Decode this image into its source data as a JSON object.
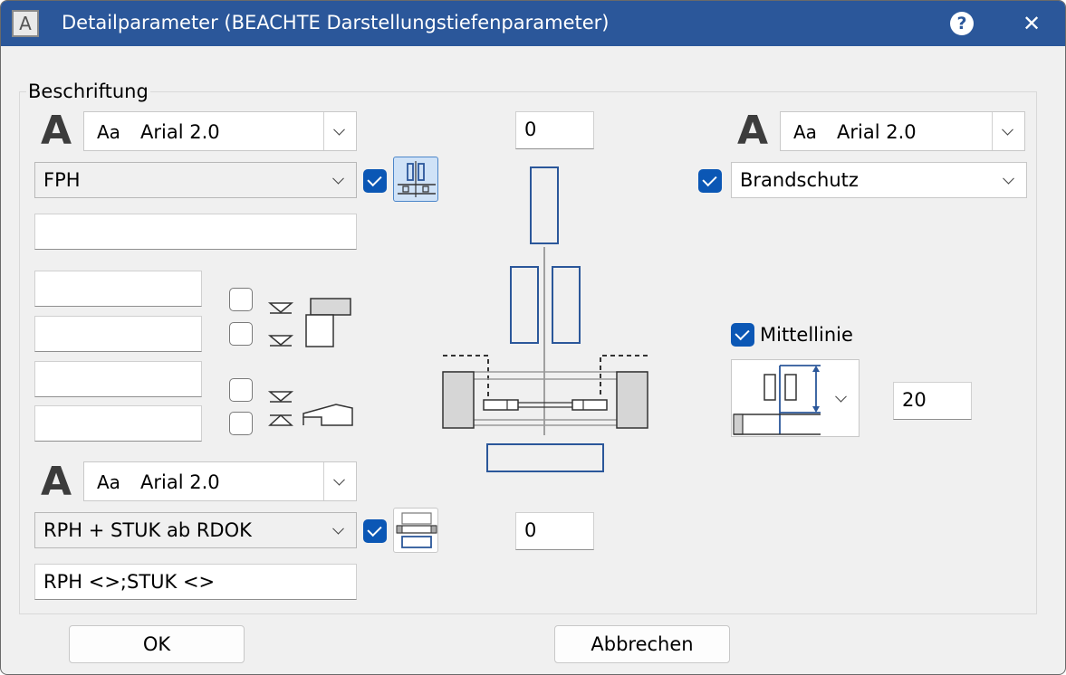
{
  "window": {
    "title": "Detailparameter (BEACHTE Darstellungstiefenparameter)",
    "app_icon_letter": "A",
    "help_symbol": "?",
    "close_symbol": "✕",
    "accent": "#2b579a"
  },
  "group": {
    "label": "Beschriftung"
  },
  "top_left": {
    "font_icon": "A",
    "font_sample": "Aa",
    "font_name": "Arial 2.0",
    "combo_value": "FPH",
    "checkbox_checked": true,
    "text_field": ""
  },
  "middle_left": {
    "fields": [
      "",
      "",
      "",
      ""
    ],
    "checkboxes": [
      false,
      false,
      false,
      false
    ]
  },
  "bottom_left": {
    "font_icon": "A",
    "font_sample": "Aa",
    "font_name": "Arial 2.0",
    "combo_value": "RPH + STUK ab RDOK",
    "checkbox_checked": true,
    "text_field": "RPH <>;STUK <>"
  },
  "center": {
    "top_value": "0",
    "bottom_value": "0"
  },
  "right": {
    "font_icon": "A",
    "font_sample": "Aa",
    "font_name": "Arial 2.0",
    "checkbox_checked": true,
    "combo_value": "Brandschutz",
    "mittellinie_label": "Mittellinie",
    "mittellinie_checked": true,
    "mittellinie_value": "20"
  },
  "buttons": {
    "ok": "OK",
    "cancel": "Abbrechen"
  },
  "icons": {
    "top_layout": "wall-layout-icon",
    "bottom_layout": "wall-section-icon",
    "dropdown": "chevron-down-icon"
  }
}
